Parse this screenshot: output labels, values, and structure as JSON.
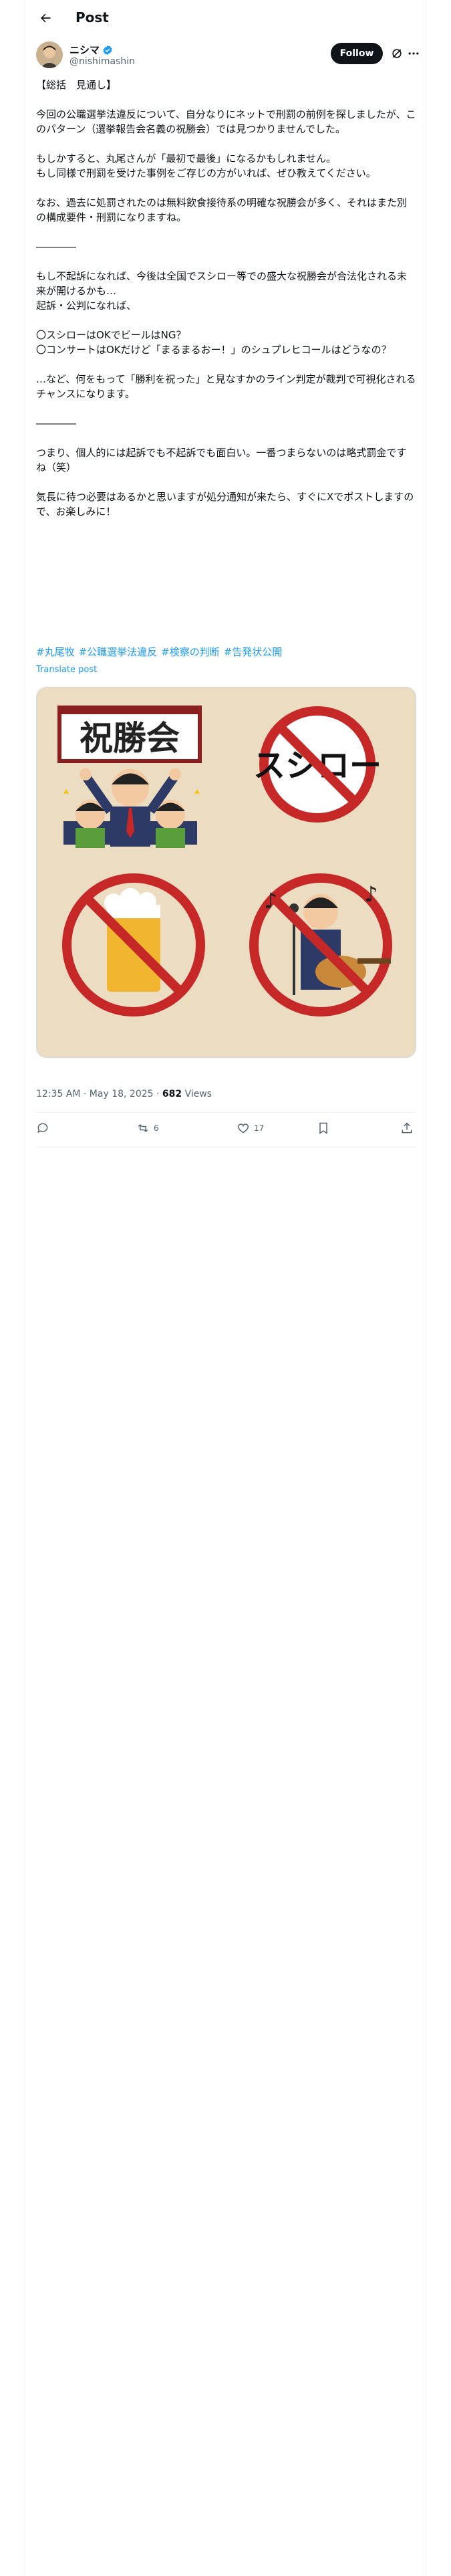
{
  "header": {
    "title": "Post"
  },
  "author": {
    "name": "ニシマ",
    "handle": "@nishimashin",
    "follow_label": "Follow"
  },
  "post": {
    "text": "【総括　見通し】\n\n今回の公職選挙法違反について、自分なりにネットで刑罰の前例を探しましたが、このパターン（選挙報告会名義の祝勝会）では見つかりませんでした。\n\nもしかすると、丸尾さんが「最初で最後」になるかもしれません。\nもし同様で刑罰を受けた事例をご存じの方がいれば、ぜひ教えてください。\n\nなお、過去に処罰されたのは無料飲食接待系の明確な祝勝会が多く、それはまた別の構成要件・刑罰になりますね。\n\n――――\n\nもし不起訴になれば、今後は全国でスシロー等での盛大な祝勝会が合法化される未来が開けるかも…\n起訴・公判になれば、\n\n〇スシローはOKでビールはNG？\n〇コンサートはOKだけど「まるまるおー！」のシュプレヒコールはどうなの？\n\n…など、何をもって「勝利を祝った」と見なすかのライン判定が裁判で可視化されるチャンスになります。\n\n――――\n\nつまり、個人的には起訴でも不起訴でも面白い。一番つまらないのは略式罰金ですね（笑）\n\n気長に待つ必要はあるかと思いますが処分通知が来たら、すぐにXでポストしますので、お楽しみに！",
    "hashtags": [
      "#丸尾牧",
      "#公職選挙法違反",
      "#検察の判断",
      "#告発状公開"
    ],
    "translate_label": "Translate post",
    "image": {
      "sign_text": "祝勝会",
      "sushi_text": "スシロー"
    },
    "timestamp": "12:35 AM · May 18, 2025 · ",
    "views_count": "682",
    "views_label": " Views"
  },
  "actions": {
    "reposts": "6",
    "likes": "17"
  },
  "colors": {
    "accent": "#1d9bf0",
    "text": "#0f1419",
    "muted": "#536471",
    "prohibit": "#c62828"
  }
}
